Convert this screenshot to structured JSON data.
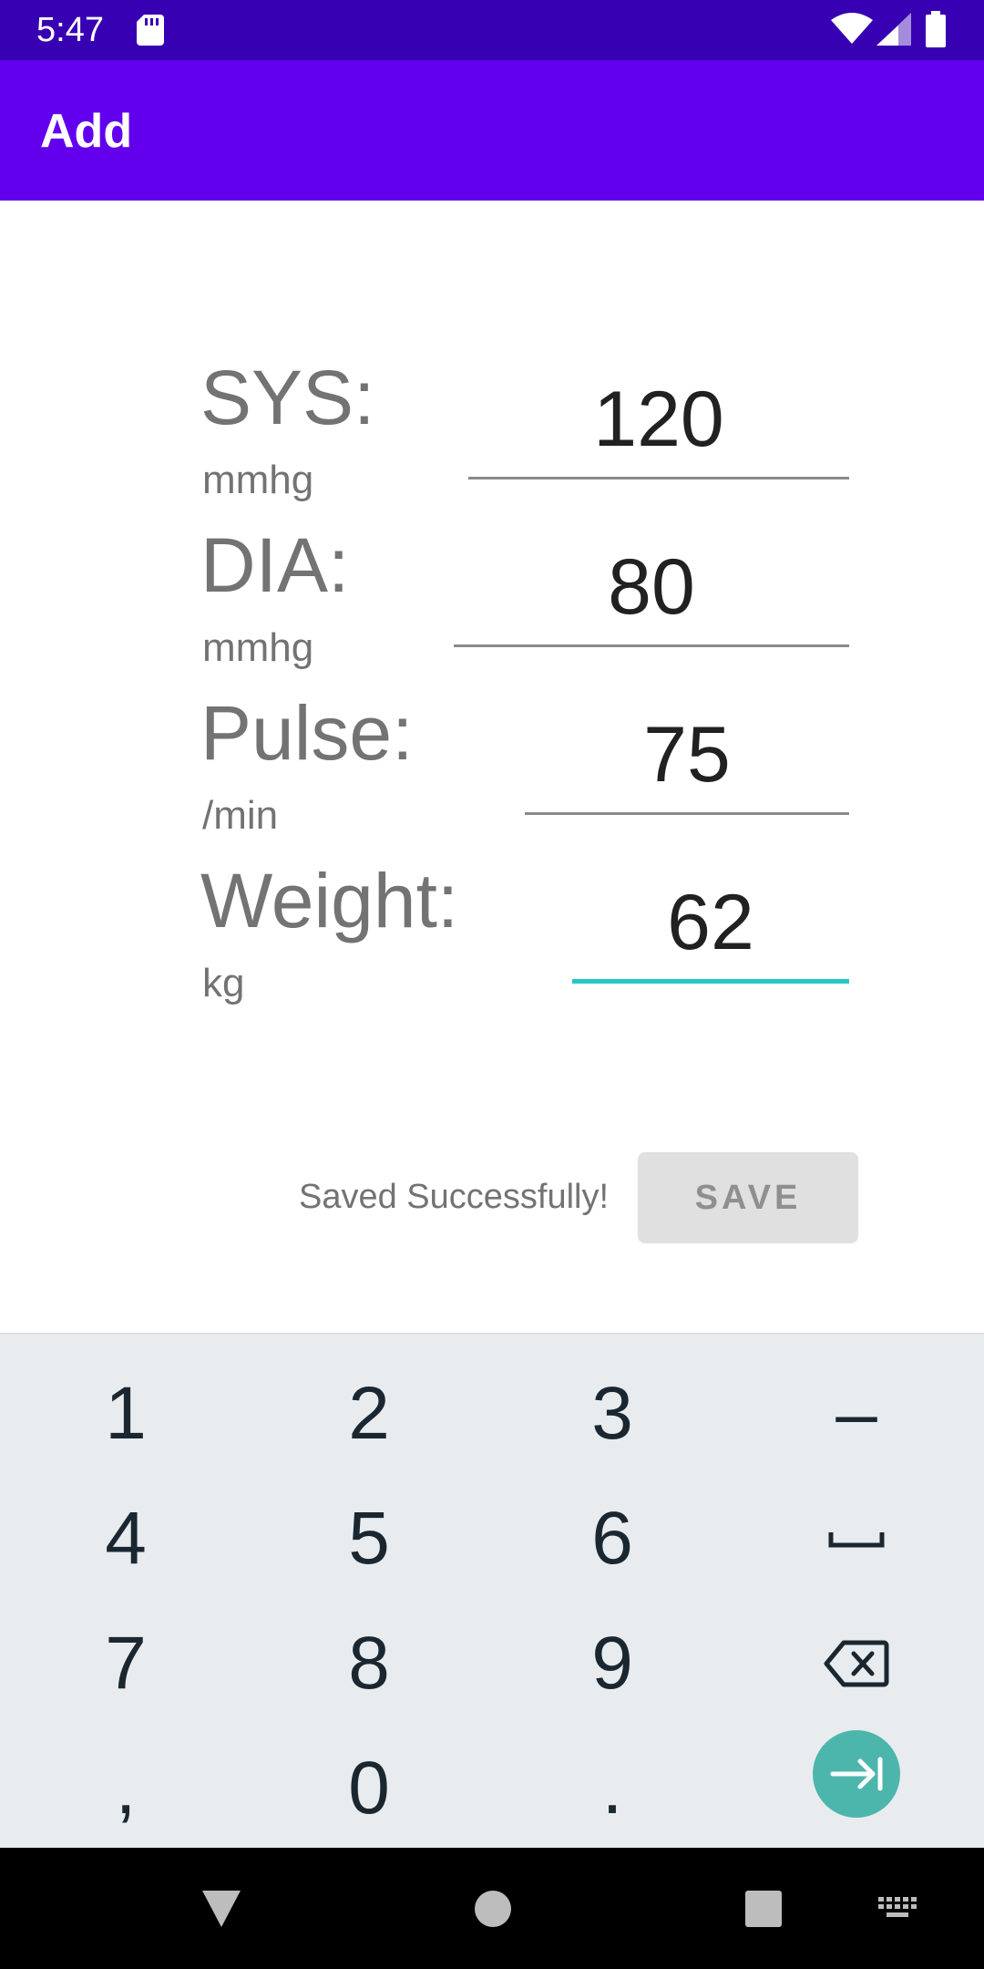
{
  "status_bar": {
    "time": "5:47"
  },
  "app_bar": {
    "title": "Add"
  },
  "form": {
    "sys": {
      "label": "SYS:",
      "unit": "mmhg",
      "value": "120"
    },
    "dia": {
      "label": "DIA:",
      "unit": "mmhg",
      "value": "80"
    },
    "pulse": {
      "label": "Pulse:",
      "unit": "/min",
      "value": "75"
    },
    "weight": {
      "label": "Weight:",
      "unit": "kg",
      "value": "62"
    }
  },
  "save": {
    "status_text": "Saved Successfully!",
    "button_label": "SAVE"
  },
  "keyboard": {
    "keys": {
      "k1": "1",
      "k2": "2",
      "k3": "3",
      "dash": "–",
      "k4": "4",
      "k5": "5",
      "k6": "6",
      "k7": "7",
      "k8": "8",
      "k9": "9",
      "comma": ",",
      "k0": "0",
      "period": "."
    },
    "icons": [
      "space-icon",
      "backspace-icon",
      "next-field-icon"
    ]
  },
  "nav_bar": {
    "icons": [
      "back-icon",
      "home-icon",
      "recents-icon",
      "keyboard-switch-icon"
    ]
  },
  "colors": {
    "status_bar": "#3700b3",
    "app_bar": "#6200ee",
    "accent": "#26c6c6",
    "keyboard_bg": "#e8ecef",
    "action_key": "#4db6ac"
  }
}
